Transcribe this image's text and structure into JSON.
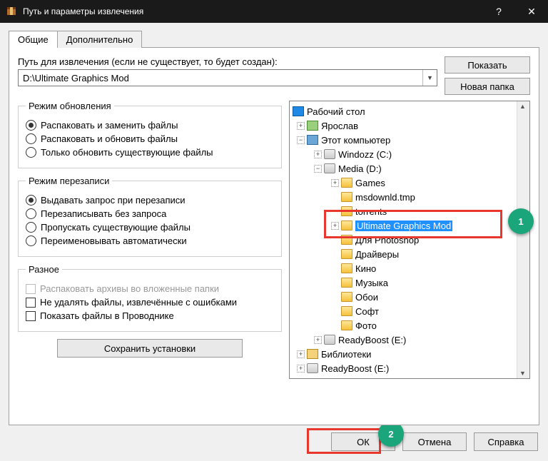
{
  "title": "Путь и параметры извлечения",
  "tabs": {
    "general": "Общие",
    "advanced": "Дополнительно"
  },
  "path": {
    "label": "Путь для извлечения (если не существует, то будет создан):",
    "value": "D:\\Ultimate Graphics Mod"
  },
  "buttons": {
    "show": "Показать",
    "newFolder": "Новая папка",
    "save": "Сохранить установки",
    "ok": "ОК",
    "cancel": "Отмена",
    "help": "Справка"
  },
  "groups": {
    "update": {
      "legend": "Режим обновления",
      "o1": "Распаковать и заменить файлы",
      "o2": "Распаковать и обновить файлы",
      "o3": "Только обновить существующие файлы"
    },
    "overwrite": {
      "legend": "Режим перезаписи",
      "o1": "Выдавать запрос при перезаписи",
      "o2": "Перезаписывать без запроса",
      "o3": "Пропускать существующие файлы",
      "o4": "Переименовывать автоматически"
    },
    "misc": {
      "legend": "Разное",
      "o1": "Распаковать архивы во вложенные папки",
      "o2": "Не удалять файлы, извлечённые с ошибками",
      "o3": "Показать файлы в Проводнике"
    }
  },
  "tree": {
    "desktop": "Рабочий стол",
    "user": "Ярослав",
    "pc": "Этот компьютер",
    "c": "Windozz (C:)",
    "d": "Media (D:)",
    "games": "Games",
    "msdown": "msdownld.tmp",
    "torrents": "torrents",
    "ugm": "Ultimate Graphics Mod",
    "ps": "Для Photoshop",
    "drivers": "Драйверы",
    "kino": "Кино",
    "music": "Музыка",
    "wall": "Обои",
    "soft": "Софт",
    "photo": "Фото",
    "e": "ReadyBoost (E:)",
    "lib": "Библиотеки",
    "e2": "ReadyBoost (E:)"
  },
  "callouts": {
    "one": "1",
    "two": "2"
  }
}
